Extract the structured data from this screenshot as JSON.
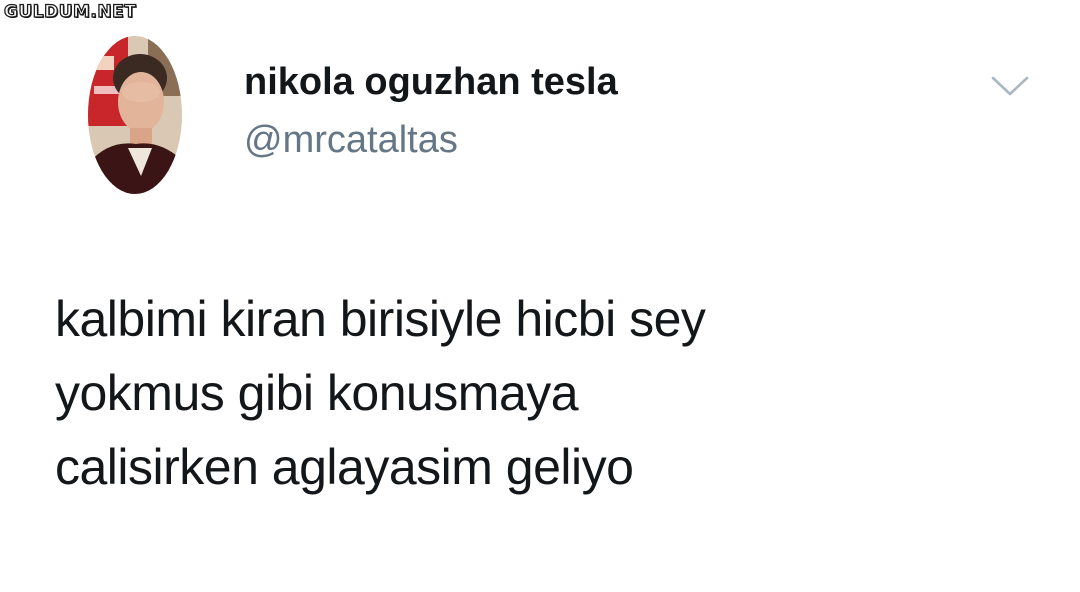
{
  "watermark": {
    "text": "GULDUM.NET"
  },
  "tweet": {
    "author": {
      "display_name": "nikola oguzhan tesla",
      "handle": "@mrcataltas"
    },
    "menu_icon": "chevron-down-icon",
    "text_lines": [
      "kalbimi kiran birisiyle hicbi sey",
      "yokmus gibi konusmaya",
      "calisirken aglayasim geliyo"
    ]
  },
  "colors": {
    "background": "#ffffff",
    "name": "#14171a",
    "handle": "#657786",
    "chevron": "#aab8c2"
  }
}
